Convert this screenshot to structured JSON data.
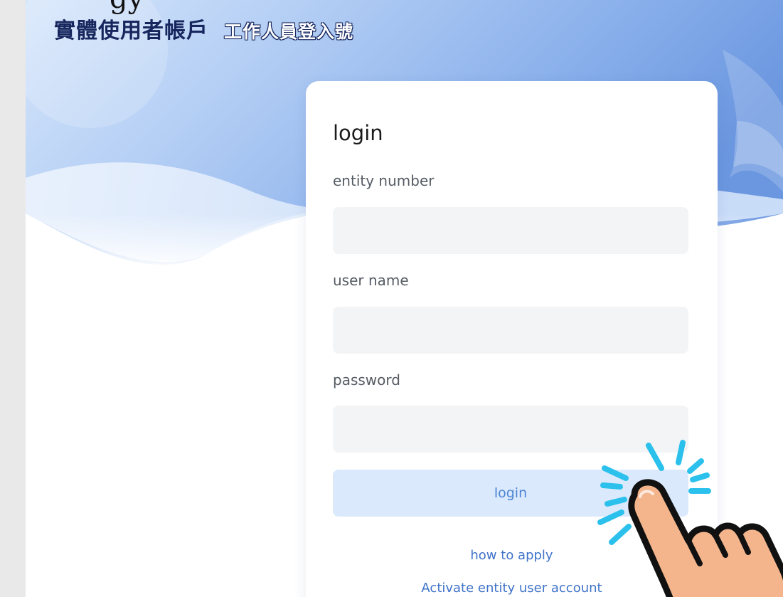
{
  "header": {
    "top_cut_text": "gy",
    "title_main": "實體使用者帳戶",
    "title_sub": "工作人員登入號"
  },
  "login_card": {
    "title": "login",
    "entity_number_label": "entity number",
    "entity_number_value": "",
    "user_name_label": "user name",
    "user_name_value": "",
    "password_label": "password",
    "password_value": "",
    "login_button_label": "login",
    "how_to_apply_link": "how to apply",
    "activate_link": "Activate entity user account"
  },
  "overlay": {
    "icon": "pointing-hand-click-icon",
    "accent_color": "#2bc1ec",
    "skin_color": "#f4b58c"
  },
  "colors": {
    "title_main": "#17275e",
    "button_bg": "#dbe9fc",
    "button_text": "#4b84d4",
    "link": "#3f73c9",
    "input_bg": "#f3f4f6"
  }
}
